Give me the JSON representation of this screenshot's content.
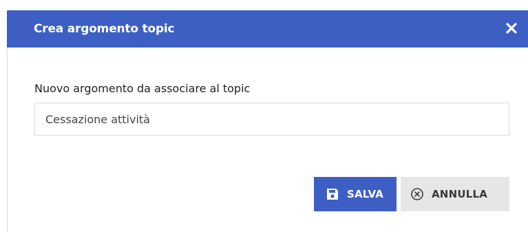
{
  "dialog": {
    "title": "Crea argomento topic",
    "close_icon": "close-icon"
  },
  "form": {
    "label": "Nuovo argomento da associare al topic",
    "input_value": "Cessazione attività"
  },
  "actions": {
    "save_label": "SALVA",
    "save_icon": "floppy-disk-icon",
    "cancel_label": "ANNULLA",
    "cancel_icon": "circle-x-icon"
  },
  "colors": {
    "header_bg": "#3d5fc4",
    "save_bg": "#3d5fc4",
    "cancel_bg": "#e6e6e6"
  }
}
